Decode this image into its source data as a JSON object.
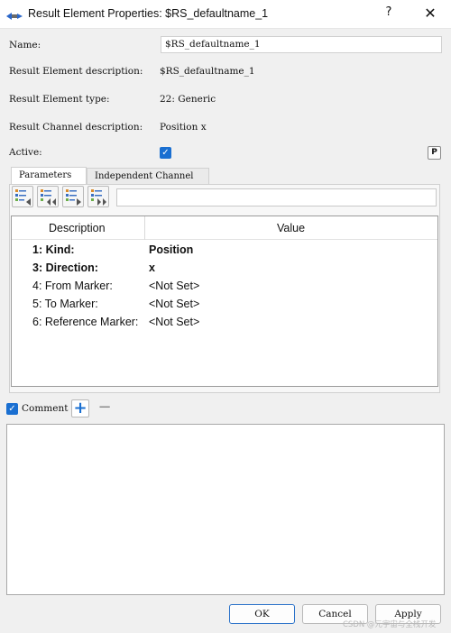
{
  "window": {
    "title": "Result Element Properties: $RS_defaultname_1",
    "help_label": "?",
    "close_label": "✕"
  },
  "form": {
    "name_label": "Name:",
    "name_value": "$RS_defaultname_1",
    "description_label": "Result Element description:",
    "description_value": "$RS_defaultname_1",
    "type_label": "Result Element type:",
    "type_value": "22: Generic",
    "channel_label": "Result Channel description:",
    "channel_value": "Position x",
    "active_label": "Active:",
    "active_checked": true,
    "p_button_label": "P"
  },
  "tabs": [
    {
      "label": "Parameters",
      "active": true
    },
    {
      "label": "Independent Channel",
      "active": false
    }
  ],
  "toolbar": {
    "icons": [
      "list-step-back-icon",
      "list-rewind-icon",
      "list-step-forward-icon",
      "list-fast-forward-icon"
    ],
    "field_value": ""
  },
  "grid": {
    "headers": [
      "Description",
      "Value"
    ],
    "rows": [
      {
        "description": "1: Kind:",
        "value": "Position",
        "bold": true
      },
      {
        "description": "3: Direction:",
        "value": "x",
        "bold": true
      },
      {
        "description": "4: From Marker:",
        "value": "<Not Set>",
        "bold": false
      },
      {
        "description": "5: To Marker:",
        "value": "<Not Set>",
        "bold": false
      },
      {
        "description": "6: Reference Marker:",
        "value": "<Not Set>",
        "bold": false
      }
    ]
  },
  "comment": {
    "label": "Comment",
    "checked": true,
    "add_label": "+",
    "remove_label": "−",
    "text": ""
  },
  "buttons": {
    "ok": "OK",
    "cancel": "Cancel",
    "apply": "Apply"
  },
  "watermark": "CSDN @元宇宙与全栈开发",
  "colors": {
    "accent": "#1a6fd1",
    "titlebar": "#ffffff",
    "dialog_bg": "#f0f0f0"
  }
}
